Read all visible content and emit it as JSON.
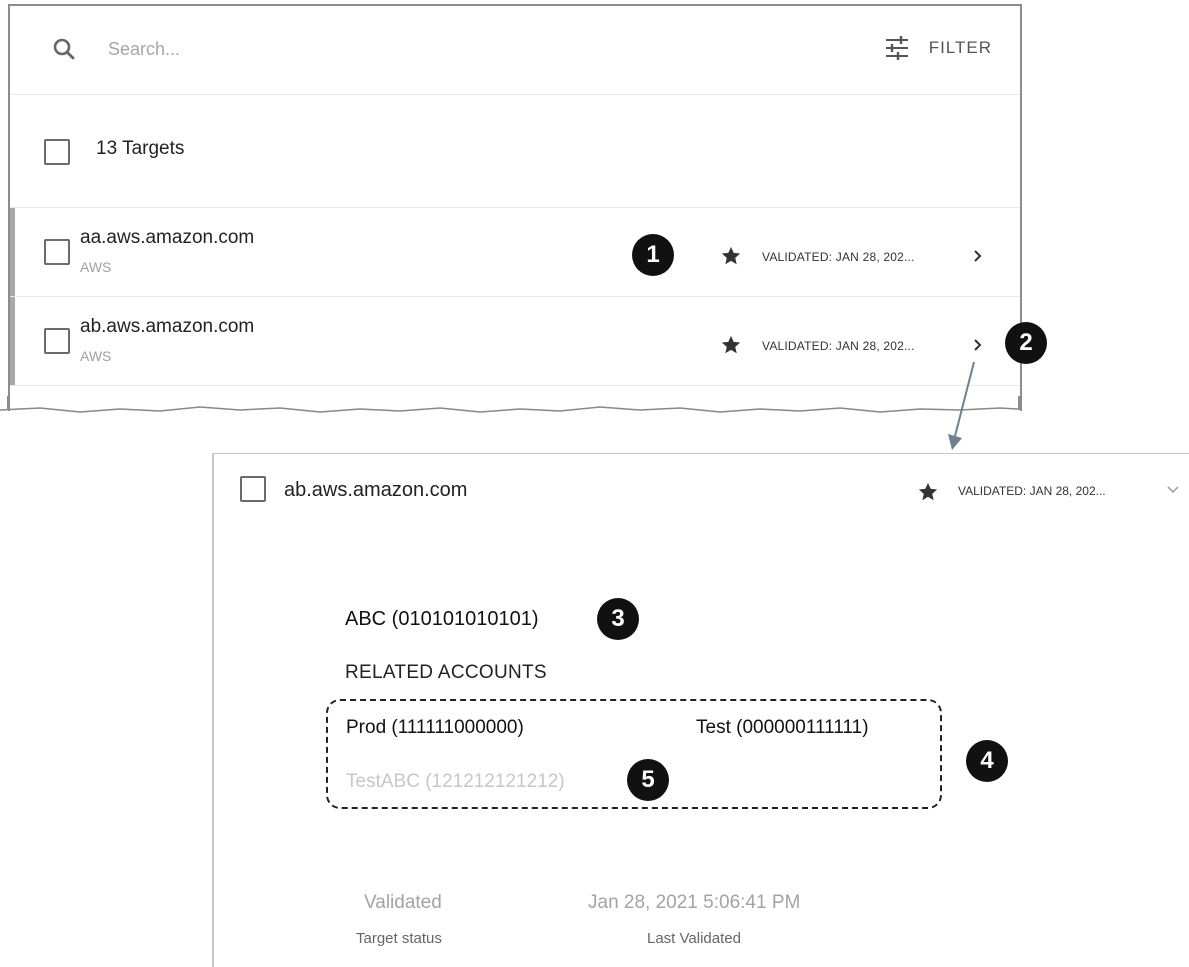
{
  "search": {
    "placeholder": "Search..."
  },
  "filter": {
    "label": "FILTER"
  },
  "list": {
    "count_label": "13 Targets",
    "rows": [
      {
        "name": "aa.aws.amazon.com",
        "type": "AWS",
        "status": "VALIDATED: JAN 28, 202..."
      },
      {
        "name": "ab.aws.amazon.com",
        "type": "AWS",
        "status": "VALIDATED: JAN 28, 202..."
      }
    ]
  },
  "detail": {
    "name": "ab.aws.amazon.com",
    "status": "VALIDATED: JAN 28, 202...",
    "account": "ABC (010101010101)",
    "related_title": "RELATED ACCOUNTS",
    "related_accounts": [
      {
        "label": "Prod (111111000000)",
        "enabled": true
      },
      {
        "label": "Test (000000111111)",
        "enabled": true
      },
      {
        "label": "TestABC (121212121212)",
        "enabled": false
      }
    ],
    "target_status_value": "Validated",
    "target_status_label": "Target status",
    "last_validated_value": "Jan 28, 2021 5:06:41 PM",
    "last_validated_label": "Last Validated"
  },
  "callouts": [
    "1",
    "2",
    "3",
    "4",
    "5"
  ],
  "icons": {
    "search": "search-icon",
    "filter": "sliders-icon",
    "favorite": "star-icon",
    "expand": "chevron-right-icon",
    "collapse": "chevron-down-icon"
  },
  "colors": {
    "callout_bg": "#111111",
    "accent_bar": "#a9a9a9",
    "disabled_text": "#c7c7c7",
    "muted_text": "#a3a3a3"
  }
}
